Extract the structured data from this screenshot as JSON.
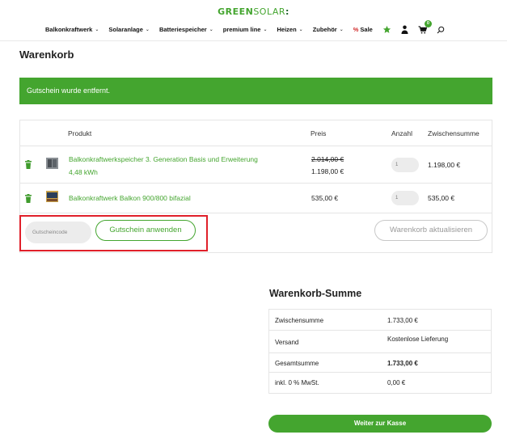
{
  "brand": {
    "part1": "GREEN",
    "part2": "SOLAR",
    "mark": ":"
  },
  "nav": {
    "items": [
      {
        "label": "Balkonkraftwerk"
      },
      {
        "label": "Solaranlage"
      },
      {
        "label": "Batteriespeicher"
      },
      {
        "label": "premium line"
      },
      {
        "label": "Heizen"
      },
      {
        "label": "Zubehör"
      }
    ],
    "sale_label": "Sale",
    "sale_prefix": "%",
    "cart_count": "0",
    "icons": [
      "star-icon",
      "user-icon",
      "cart-icon",
      "search-icon"
    ]
  },
  "page": {
    "title": "Warenkorb"
  },
  "notice": {
    "text": "Gutschein wurde entfernt."
  },
  "cart": {
    "headers": {
      "product": "Produkt",
      "price": "Preis",
      "qty": "Anzahl",
      "subtotal": "Zwischensumme"
    },
    "items": [
      {
        "name_line1": "Balkonkraftwerkspeicher 3. Generation Basis und Erweiterung",
        "name_line2": "4,48 kWh",
        "old_price": "2.014,00 €",
        "price": "1.198,00 €",
        "qty": "1",
        "subtotal": "1.198,00 €"
      },
      {
        "name_line1": "Balkonkraftwerk Balkon 900/800 bifazial",
        "price": "535,00 €",
        "qty": "1",
        "subtotal": "535,00 €"
      }
    ],
    "coupon_placeholder": "Gutscheincode",
    "apply_coupon_label": "Gutschein anwenden",
    "update_cart_label": "Warenkorb aktualisieren"
  },
  "totals": {
    "title": "Warenkorb-Summe",
    "rows": [
      {
        "label": "Zwischensumme",
        "value": "1.733,00 €"
      },
      {
        "label": "Versand",
        "value": "Kostenlose Lieferung"
      },
      {
        "label": "Gesamtsumme",
        "value": "1.733,00 €"
      },
      {
        "label": "inkl. 0 % MwSt.",
        "value": "0,00 €"
      }
    ],
    "checkout_label": "Weiter zur Kasse"
  },
  "colors": {
    "accent": "#44a52f",
    "highlight": "#e0202a",
    "trash": "#3f9b2c"
  }
}
